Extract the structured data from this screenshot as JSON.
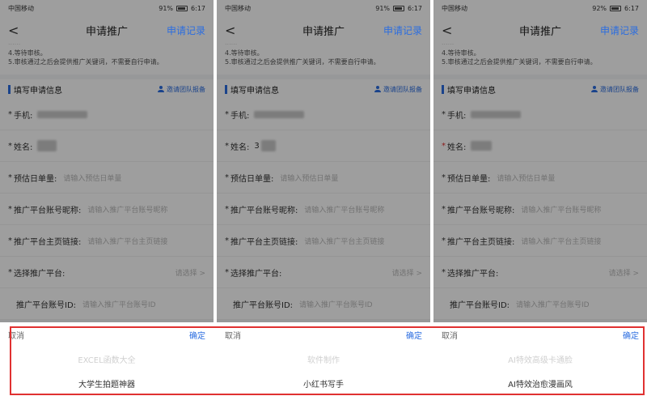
{
  "phones": [
    {
      "status": {
        "carrier": "中国移动",
        "battery": "91%",
        "time": "6:17"
      },
      "nav": {
        "back": "<",
        "title": "申请推广",
        "record": "申请记录"
      },
      "notice": [
        "4.等待审核。",
        "5.审核通过之后会提供推广关键词，不需要自行申请。"
      ],
      "section": {
        "label": "填写申请信息",
        "invite": "邀请团队报备"
      },
      "form": {
        "phone_label": "手机:",
        "name_label": "姓名:",
        "daily_label": "预估日单量:",
        "daily_ph": "请输入预估日单量",
        "account_label": "推广平台账号昵称:",
        "account_ph": "请输入推广平台账号昵称",
        "link_label": "推广平台主页链接:",
        "link_ph": "请输入推广平台主页链接",
        "platform_label": "选择推广平台:",
        "platform_ph": "请选择 >",
        "id_label": "推广平台账号ID:",
        "id_ph": "请输入推广平台账号ID"
      },
      "sheet": {
        "cancel": "取消",
        "ok": "确定",
        "options": [
          "EXCEL函数大全",
          "大学生拍题神器"
        ]
      }
    },
    {
      "status": {
        "carrier": "中国移动",
        "battery": "91%",
        "time": "6:17"
      },
      "nav": {
        "back": "<",
        "title": "申请推广",
        "record": "申请记录"
      },
      "notice": [
        "4.等待审核。",
        "5.审核通过之后会提供推广关键词，不需要自行申请。"
      ],
      "section": {
        "label": "填写申请信息",
        "invite": "邀请团队报备"
      },
      "form": {
        "phone_label": "手机:",
        "name_label": "姓名:",
        "name_visible": "3",
        "daily_label": "预估日单量:",
        "daily_ph": "请输入预估日单量",
        "account_label": "推广平台账号昵称:",
        "account_ph": "请输入推广平台账号昵称",
        "link_label": "推广平台主页链接:",
        "link_ph": "请输入推广平台主页链接",
        "platform_label": "选择推广平台:",
        "platform_ph": "请选择 >",
        "id_label": "推广平台账号ID:",
        "id_ph": "请输入推广平台账号ID"
      },
      "sheet": {
        "cancel": "取消",
        "ok": "确定",
        "options": [
          "软件制作",
          "小红书写手"
        ]
      }
    },
    {
      "status": {
        "carrier": "中国移动",
        "battery": "92%",
        "time": "6:17"
      },
      "nav": {
        "back": "<",
        "title": "申请推广",
        "record": "申请记录"
      },
      "notice": [
        "4.等待审核。",
        "5.审核通过之后会提供推广关键词，不需要自行申请。"
      ],
      "section": {
        "label": "填写申请信息",
        "invite": "邀请团队报备"
      },
      "form": {
        "phone_label": "手机:",
        "name_label": "姓名:",
        "daily_label": "预估日单量:",
        "daily_ph": "请输入预估日单量",
        "account_label": "推广平台账号昵称:",
        "account_ph": "请输入推广平台账号昵称",
        "link_label": "推广平台主页链接:",
        "link_ph": "请输入推广平台主页链接",
        "platform_label": "选择推广平台:",
        "platform_ph": "请选择 >",
        "id_label": "推广平台账号ID:",
        "id_ph": "请输入推广平台账号ID"
      },
      "sheet": {
        "cancel": "取消",
        "ok": "确定",
        "options": [
          "AI特效高级卡通脸",
          "AI特效治愈漫画风"
        ]
      }
    }
  ],
  "colors": {
    "accent": "#2b6de0",
    "highlight": "#e03131",
    "required_star": "#e03131"
  }
}
